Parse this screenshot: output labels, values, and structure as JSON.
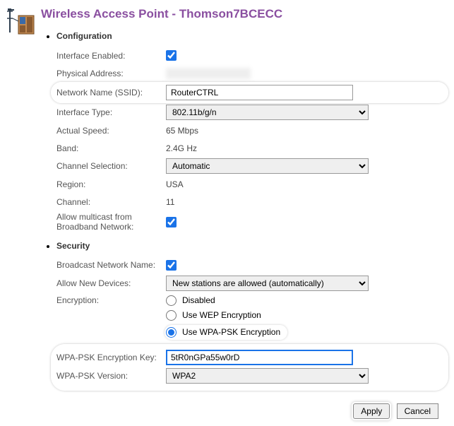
{
  "title": "Wireless Access Point - Thomson7BCECC",
  "sections": {
    "configuration": {
      "heading": "Configuration",
      "fields": {
        "interface_enabled_label": "Interface Enabled:",
        "interface_enabled": true,
        "physical_address_label": "Physical Address:",
        "physical_address": "",
        "ssid_label": "Network Name (SSID):",
        "ssid_value": "RouterCTRL",
        "interface_type_label": "Interface Type:",
        "interface_type_value": "802.11b/g/n",
        "actual_speed_label": "Actual Speed:",
        "actual_speed_value": "65 Mbps",
        "band_label": "Band:",
        "band_value": "2.4G Hz",
        "channel_selection_label": "Channel Selection:",
        "channel_selection_value": "Automatic",
        "region_label": "Region:",
        "region_value": "USA",
        "channel_label": "Channel:",
        "channel_value": "11",
        "allow_multicast_label": "Allow multicast from Broadband Network:",
        "allow_multicast": true
      }
    },
    "security": {
      "heading": "Security",
      "fields": {
        "broadcast_label": "Broadcast Network Name:",
        "broadcast": true,
        "allow_new_label": "Allow New Devices:",
        "allow_new_value": "New stations are allowed (automatically)",
        "encryption_label": "Encryption:",
        "encryption_options": {
          "disabled": "Disabled",
          "wep": "Use WEP Encryption",
          "wpa": "Use WPA-PSK Encryption"
        },
        "encryption_selected": "wpa",
        "wpa_key_label": "WPA-PSK Encryption Key:",
        "wpa_key_value": "5tR0nGPa55w0rD",
        "wpa_version_label": "WPA-PSK Version:",
        "wpa_version_value": "WPA2"
      }
    }
  },
  "buttons": {
    "apply": "Apply",
    "cancel": "Cancel"
  }
}
